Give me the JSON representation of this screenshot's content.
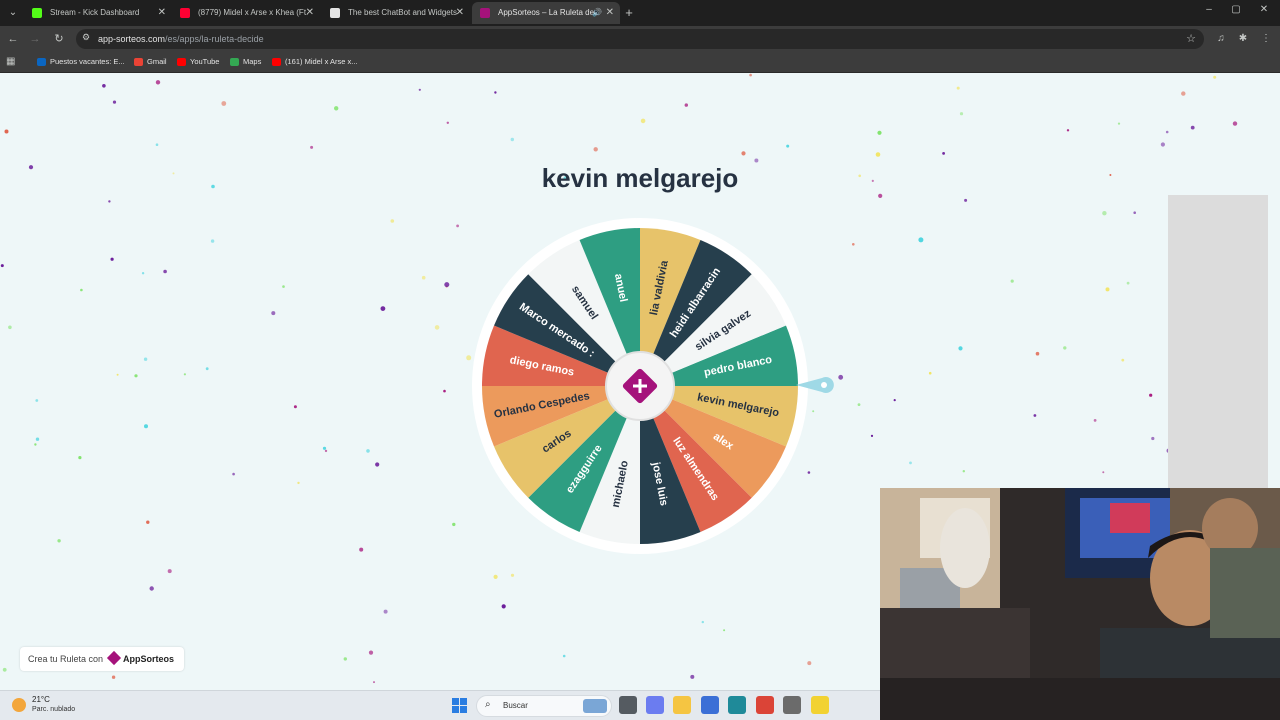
{
  "browser": {
    "tabs": [
      {
        "title": "Stream - Kick Dashboard",
        "active": false,
        "favicon_color": "#53fc18"
      },
      {
        "title": "(8779) Midel x Arse x Khea (Ft.",
        "active": false,
        "favicon_color": "#ff0033"
      },
      {
        "title": "The best ChatBot and Widgets",
        "active": false,
        "favicon_color": "#e3e3e3"
      },
      {
        "title": "AppSorteos – La Ruleta de",
        "active": true,
        "favicon_color": "#a5127b",
        "audio": true
      }
    ],
    "url_domain": "app-sorteos.com",
    "url_path": "/es/apps/la-ruleta-decide",
    "bookmarks": [
      {
        "label": "Puestos vacantes: E...",
        "icon_color": "#0a66c2"
      },
      {
        "label": "Gmail",
        "icon_color": "#ea4335"
      },
      {
        "label": "YouTube",
        "icon_color": "#ff0000"
      },
      {
        "label": "Maps",
        "icon_color": "#34a853"
      },
      {
        "label": "(161) Midel x Arse x...",
        "icon_color": "#ff0000"
      }
    ]
  },
  "page": {
    "winner": "kevin melgarejo",
    "credit_text": "Crea tu Ruleta con",
    "credit_brand": "AppSorteos"
  },
  "wheel": {
    "segments": [
      {
        "label": "pedro blanco",
        "color": "#2e9e82",
        "text_color": "#ffffff"
      },
      {
        "label": "kevin melgarejo",
        "color": "#e7c36a",
        "text_color": "#263242"
      },
      {
        "label": "alex",
        "color": "#ec9a5c",
        "text_color": "#ffffff"
      },
      {
        "label": "luz almendras",
        "color": "#e0654f",
        "text_color": "#ffffff"
      },
      {
        "label": "jose luis",
        "color": "#263f4d",
        "text_color": "#ffffff"
      },
      {
        "label": "michaelo",
        "color": "#f3f6f6",
        "text_color": "#263242"
      },
      {
        "label": "ezagguirre",
        "color": "#2e9e82",
        "text_color": "#ffffff"
      },
      {
        "label": "carlos",
        "color": "#e7c36a",
        "text_color": "#263242"
      },
      {
        "label": "Orlando Cespedes",
        "color": "#ec9a5c",
        "text_color": "#263242"
      },
      {
        "label": "diego ramos",
        "color": "#e0654f",
        "text_color": "#ffffff"
      },
      {
        "label": "Marco mercado :",
        "color": "#263f4d",
        "text_color": "#ffffff"
      },
      {
        "label": "samuel",
        "color": "#f3f6f6",
        "text_color": "#263242"
      },
      {
        "label": "anuel",
        "color": "#2e9e82",
        "text_color": "#ffffff"
      },
      {
        "label": "lia valdivia",
        "color": "#e7c36a",
        "text_color": "#263242"
      },
      {
        "label": "heidi albarracin",
        "color": "#263f4d",
        "text_color": "#ffffff"
      },
      {
        "label": "silvia galvez",
        "color": "#f3f6f6",
        "text_color": "#263242"
      }
    ],
    "pointer_color": "#9fd9e6",
    "hub_color": "#a5127b"
  },
  "taskbar": {
    "temperature": "21°C",
    "condition": "Parc. nublado",
    "search_placeholder": "Buscar",
    "apps": [
      {
        "icon": "task-view-icon",
        "color": "#555b61"
      },
      {
        "icon": "copilot-icon",
        "color": "#6b7cf0"
      },
      {
        "icon": "file-explorer-icon",
        "color": "#f5c542"
      },
      {
        "icon": "store-icon",
        "color": "#3b6fd6"
      },
      {
        "icon": "terminal-icon",
        "color": "#1f8a99"
      },
      {
        "icon": "chrome-icon",
        "color": "#db4437"
      },
      {
        "icon": "chrome-alt-icon",
        "color": "#6b6b6b"
      },
      {
        "icon": "sticky-notes-icon",
        "color": "#f2d232"
      }
    ]
  },
  "webcam": {
    "label": "webcam overlay"
  }
}
